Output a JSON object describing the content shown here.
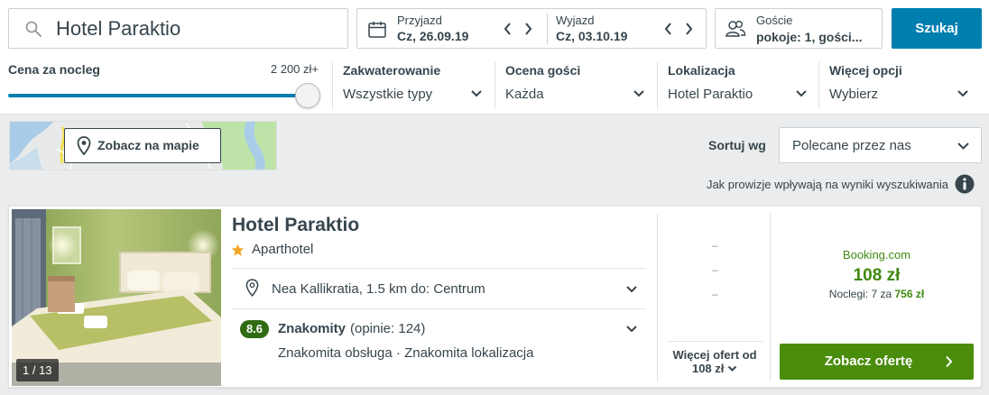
{
  "search": {
    "value": "Hotel Paraktio"
  },
  "dates": {
    "checkin_label": "Przyjazd",
    "checkin_value": "Cz, 26.09.19",
    "checkout_label": "Wyjazd",
    "checkout_value": "Cz, 03.10.19"
  },
  "guests": {
    "label": "Goście",
    "value": "pokoje: 1, gości..."
  },
  "search_button": "Szukaj",
  "filters": {
    "price": {
      "title": "Cena za nocleg",
      "max": "2 200 zł+",
      "level": 1.0
    },
    "accommodation": {
      "title": "Zakwaterowanie",
      "value": "Wszystkie typy"
    },
    "rating": {
      "title": "Ocena gości",
      "value": "Każda"
    },
    "location": {
      "title": "Lokalizacja",
      "value": "Hotel Paraktio"
    },
    "more": {
      "title": "Więcej opcji",
      "value": "Wybierz"
    }
  },
  "map": {
    "button_label": "Zobacz na mapie"
  },
  "sort": {
    "label": "Sortuj wg",
    "value": "Polecane przez nas"
  },
  "commission_note": "Jak prowizje wpływają na wyniki wyszukiwania",
  "hotel": {
    "name": "Hotel Paraktio",
    "type": "Aparthotel",
    "photo_counter": "1 / 13",
    "location": "Nea Kallikratia, 1.5 km do: Centrum",
    "rating_score": "8.6",
    "rating_word": "Znakomity",
    "rating_count": "(opinie: 124)",
    "rating_details": "Znakomita obsługa · Znakomita lokalizacja",
    "placeholder_dashes": [
      "–",
      "–",
      "–"
    ],
    "more_offers_line1": "Więcej ofert od",
    "more_offers_line2": "108 zł",
    "provider": "Booking.com",
    "price": "108 zł",
    "nights_prefix": "Noclegi: 7 za",
    "nights_total": "756 zł",
    "offer_button": "Zobacz ofertę"
  },
  "colors": {
    "accent_blue": "#007faf",
    "deal_green": "#4a8d0d",
    "price_green": "#3e8a10",
    "rating_badge": "#2f6b12",
    "star": "#f5a623"
  }
}
